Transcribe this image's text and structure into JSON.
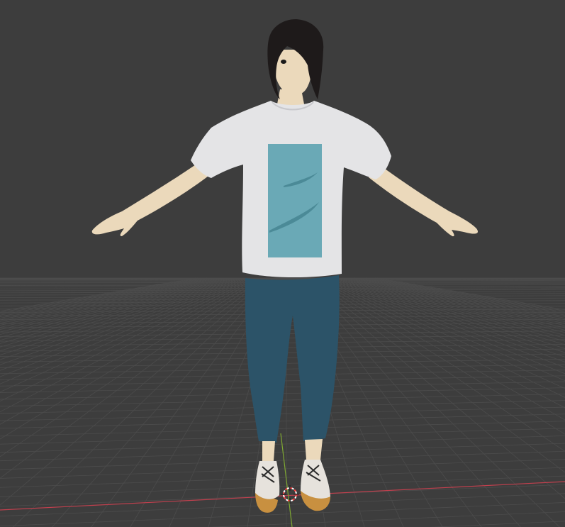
{
  "viewport": {
    "background_color": "#3d3d3d",
    "grid_color": "#4c4c4c",
    "x_axis_color": "#c0404e",
    "y_axis_color": "#7fa832",
    "cursor_3d": {
      "icon": "3d-cursor-icon",
      "ring_colors": [
        "#ff4040",
        "#ffffff"
      ]
    },
    "character": {
      "hair_color": "#1e1a1a",
      "skin_color": "#ebd9bb",
      "shirt_color": "#e4e4e6",
      "shirt_print_color": "#6aa9b6",
      "pants_color": "#2c5368",
      "sneaker_color": "#e6e2dc",
      "sole_color": "#c89040"
    }
  }
}
